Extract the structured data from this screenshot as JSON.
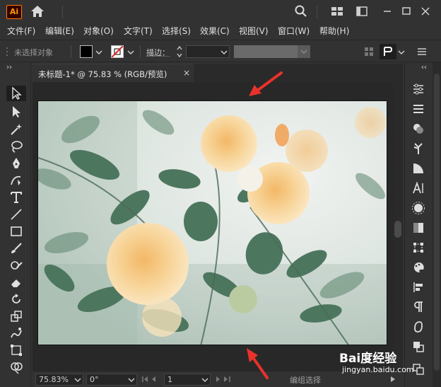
{
  "app": {
    "logo_text": "Ai"
  },
  "menu": [
    "文件(F)",
    "编辑(E)",
    "对象(O)",
    "文字(T)",
    "选择(S)",
    "效果(C)",
    "视图(V)",
    "窗口(W)",
    "帮助(H)"
  ],
  "control_bar": {
    "selection_label": "未选择对象",
    "stroke_label": "描边：",
    "stroke_value": ""
  },
  "document": {
    "tab_title": "未标题-1* @ 75.83 % (RGB/预览)",
    "close_glyph": "×"
  },
  "status_bar": {
    "zoom": "75.83%",
    "rotation": "0°",
    "page": "1",
    "status_text": "编组选择"
  },
  "watermark": {
    "line1": "Bai度经验",
    "line2": "jingyan.baidu.com"
  },
  "colors": {
    "accent": "#ff7c00",
    "annotation_arrow": "#e8322b"
  },
  "icons": {
    "toolbar": [
      "home-icon",
      "search-icon",
      "arrange-documents-icon",
      "workspace-icon",
      "minimize-icon",
      "maximize-icon",
      "close-icon"
    ],
    "tools": [
      "selection-tool-icon",
      "direct-selection-tool-icon",
      "magic-wand-icon",
      "lasso-icon",
      "pen-tool-icon",
      "curvature-tool-icon",
      "type-tool-icon",
      "line-tool-icon",
      "rectangle-tool-icon",
      "paintbrush-icon",
      "shaper-tool-icon",
      "eraser-icon",
      "rotate-tool-icon",
      "scale-tool-icon",
      "warp-tool-icon",
      "free-transform-icon",
      "shape-builder-icon"
    ]
  }
}
